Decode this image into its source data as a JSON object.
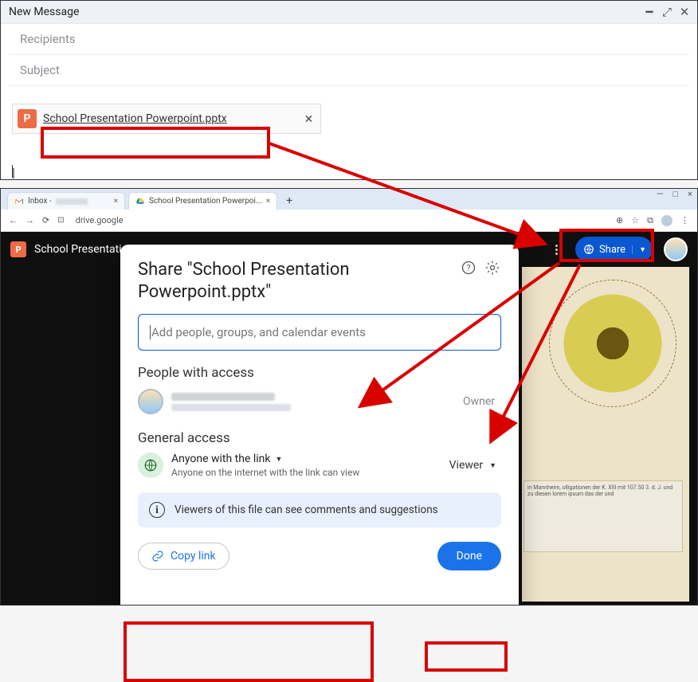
{
  "compose": {
    "title": "New Message",
    "recipients_placeholder": "Recipients",
    "subject_placeholder": "Subject",
    "attachment": {
      "name": "School Presentation Powerpoint.pptx",
      "icon_letter": "P"
    }
  },
  "browser": {
    "tabs": [
      {
        "label": "Inbox -",
        "icon": "gmail"
      },
      {
        "label": "School Presentation Powerpoi...",
        "icon": "drive"
      }
    ],
    "url": "drive.google"
  },
  "viewer": {
    "filename": "School Presentati",
    "share_label": "Share"
  },
  "dialog": {
    "title": "Share \"School Presentation Powerpoint.pptx\"",
    "input_placeholder": "Add people, groups, and calendar events",
    "people_heading": "People with access",
    "owner_label": "Owner",
    "general_heading": "General access",
    "access_main": "Anyone with the link",
    "access_sub": "Anyone on the internet with the link can view",
    "role": "Viewer",
    "banner": "Viewers of this file can see comments and suggestions",
    "copy_link": "Copy link",
    "done": "Done"
  }
}
